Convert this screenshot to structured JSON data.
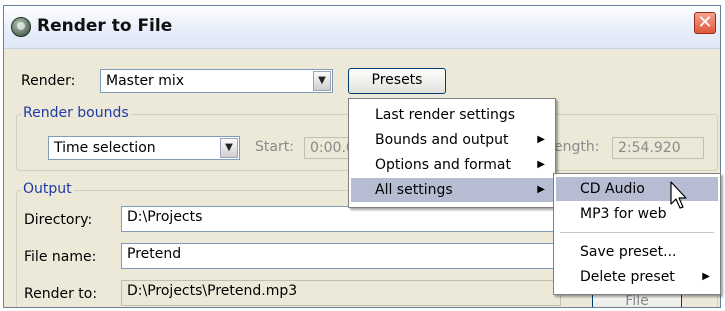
{
  "window": {
    "title": "Render to File",
    "close_glyph": "✕"
  },
  "render": {
    "label": "Render:",
    "value": "Master mix",
    "presets_button": "Presets"
  },
  "render_bounds": {
    "legend": "Render bounds",
    "selection": "Time selection",
    "start_label": "Start:",
    "start_value": "0:00.0",
    "length_label": "ength:",
    "length_value": "2:54.920"
  },
  "output": {
    "legend": "Output",
    "directory_label": "Directory:",
    "directory_value": "D:\\Projects",
    "filename_label": "File name:",
    "filename_value": "Pretend",
    "renderto_label": "Render to:",
    "renderto_value": "D:\\Projects\\Pretend.mp3",
    "file_button_partial": "File"
  },
  "presets_menu": {
    "items": [
      {
        "label": "Last render settings",
        "submenu": false
      },
      {
        "label": "Bounds and output",
        "submenu": true
      },
      {
        "label": "Options and format",
        "submenu": true
      },
      {
        "label": "All settings",
        "submenu": true,
        "highlighted": true
      }
    ]
  },
  "all_settings_menu": {
    "items": [
      {
        "label": "CD Audio",
        "highlighted": true
      },
      {
        "label": "MP3 for web"
      },
      {
        "label": "Save preset..."
      },
      {
        "label": "Delete preset",
        "submenu": true
      }
    ]
  },
  "icons": {
    "submenu_arrow": "▶",
    "combo_arrow": "▼"
  },
  "colors": {
    "group_legend": "#1f3aa6",
    "menu_highlight": "#b6bdd2",
    "close_button": "#e0573b"
  }
}
